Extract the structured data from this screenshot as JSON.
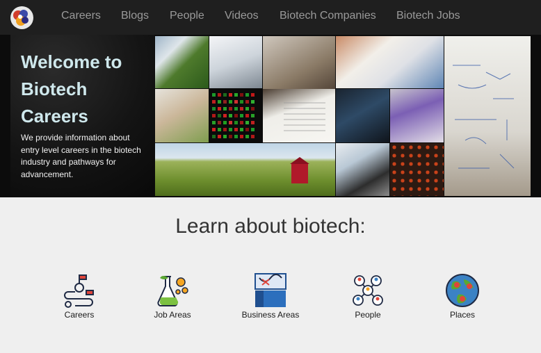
{
  "nav": {
    "links": [
      "Careers",
      "Blogs",
      "People",
      "Videos",
      "Biotech Companies",
      "Biotech Jobs"
    ]
  },
  "hero": {
    "title_lines": [
      "Welcome to",
      "Biotech",
      "Careers"
    ],
    "description": "We provide information about entry level careers in the biotech industry and pathways for advancement."
  },
  "learn": {
    "heading": "Learn about biotech:",
    "categories": [
      {
        "label": "Careers",
        "icon": "career-path-icon"
      },
      {
        "label": "Job Areas",
        "icon": "lab-flask-icon"
      },
      {
        "label": "Business Areas",
        "icon": "business-chart-icon"
      },
      {
        "label": "People",
        "icon": "people-network-icon"
      },
      {
        "label": "Places",
        "icon": "globe-map-icon"
      }
    ]
  },
  "colors": {
    "navbar_bg": "#1f1f1f",
    "nav_text": "#9a9a9a",
    "hero_title": "#cfe8ec",
    "page_bg": "#efefef"
  }
}
